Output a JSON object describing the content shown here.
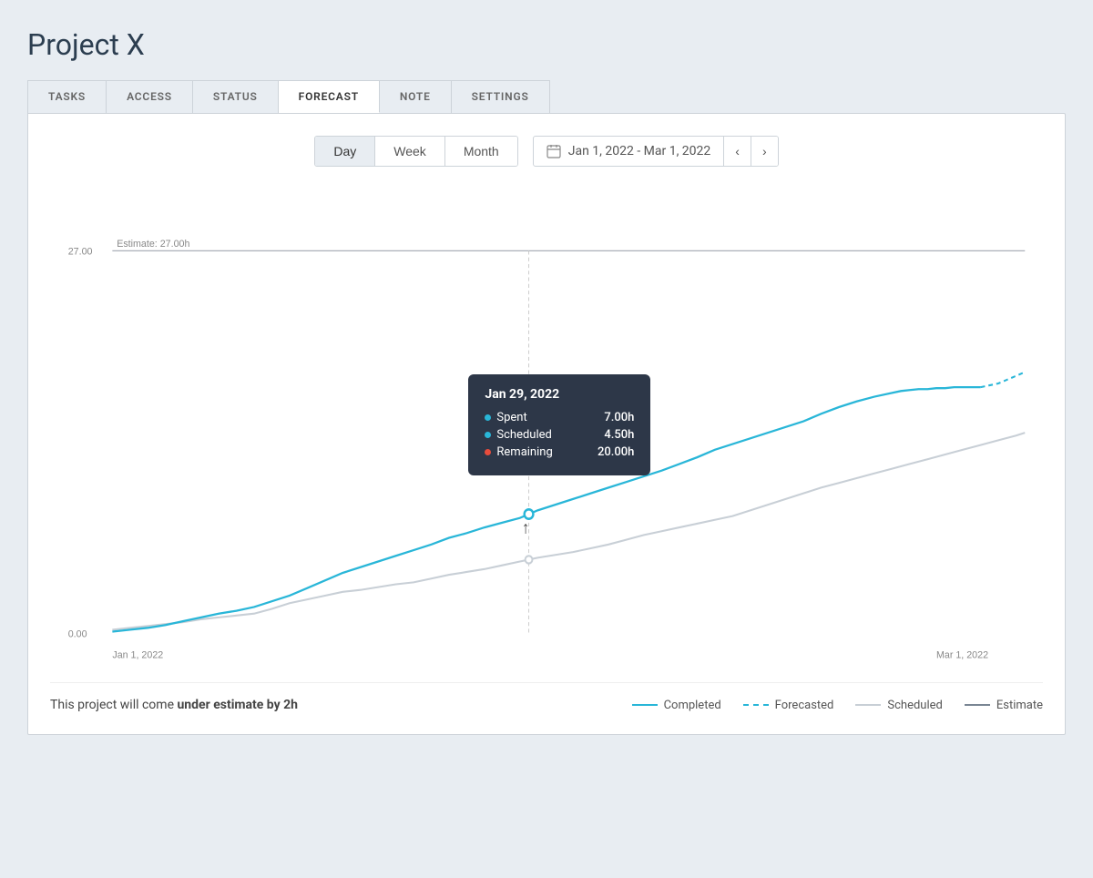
{
  "page": {
    "title": "Project X"
  },
  "tabs": [
    {
      "id": "tasks",
      "label": "TASKS",
      "active": false
    },
    {
      "id": "access",
      "label": "ACCESS",
      "active": false
    },
    {
      "id": "status",
      "label": "STATUS",
      "active": false
    },
    {
      "id": "forecast",
      "label": "FORECAST",
      "active": true
    },
    {
      "id": "note",
      "label": "NOTE",
      "active": false
    },
    {
      "id": "settings",
      "label": "SETTINGS",
      "active": false
    }
  ],
  "controls": {
    "period_buttons": [
      {
        "id": "day",
        "label": "Day",
        "active": true
      },
      {
        "id": "week",
        "label": "Week",
        "active": false
      },
      {
        "id": "month",
        "label": "Month",
        "active": false
      }
    ],
    "date_range": "Jan 1, 2022 - Mar 1, 2022",
    "prev_label": "‹",
    "next_label": "›"
  },
  "chart": {
    "estimate_label": "Estimate: 27.00h",
    "y_max": "27.00",
    "y_min": "0.00",
    "x_start": "Jan 1, 2022",
    "x_end": "Mar 1, 2022"
  },
  "tooltip": {
    "date": "Jan 29, 2022",
    "rows": [
      {
        "dot_color": "#29b6d8",
        "label": "Spent",
        "value": "7.00h"
      },
      {
        "dot_color": "#29b6d8",
        "label": "Scheduled",
        "value": "4.50h"
      },
      {
        "dot_color": "#e74c3c",
        "label": "Remaining",
        "value": "20.00h"
      }
    ]
  },
  "footer": {
    "message_prefix": "This project will come ",
    "message_bold": "under estimate by 2h",
    "legend": [
      {
        "id": "completed",
        "label": "Completed",
        "type": "solid",
        "color": "#29b6d8"
      },
      {
        "id": "forecasted",
        "label": "Forecasted",
        "type": "dashed",
        "color": "#29b6d8"
      },
      {
        "id": "scheduled",
        "label": "Scheduled",
        "type": "solid",
        "color": "#c8cfd6"
      },
      {
        "id": "estimate",
        "label": "Estimate",
        "type": "solid",
        "color": "#7a8694"
      }
    ]
  }
}
